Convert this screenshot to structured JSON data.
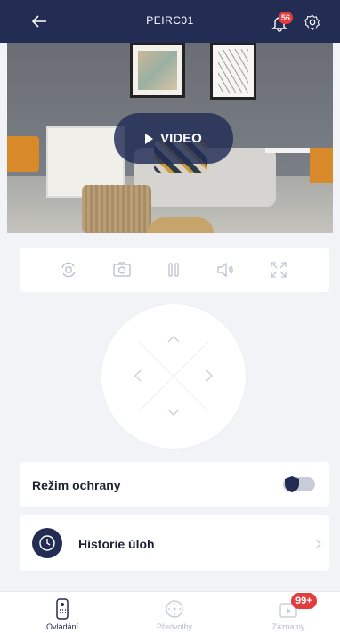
{
  "header": {
    "title": "PEIRC01",
    "notification_count": "56"
  },
  "video": {
    "play_label": "VIDEO"
  },
  "controls": {
    "icons": [
      "rotate-camera-icon",
      "snapshot-icon",
      "pause-icon",
      "speaker-icon",
      "fullscreen-icon"
    ]
  },
  "protection_mode": {
    "label": "Režim ochrany",
    "enabled": false
  },
  "task_history": {
    "label": "Historie úloh"
  },
  "tabs": [
    {
      "label": "Ovládání",
      "active": true
    },
    {
      "label": "Předvolby",
      "active": false
    },
    {
      "label": "Záznamy",
      "active": false,
      "badge": "99+"
    }
  ],
  "colors": {
    "header": "#232c52",
    "badge": "#e23c3c",
    "accent": "#232c52"
  }
}
